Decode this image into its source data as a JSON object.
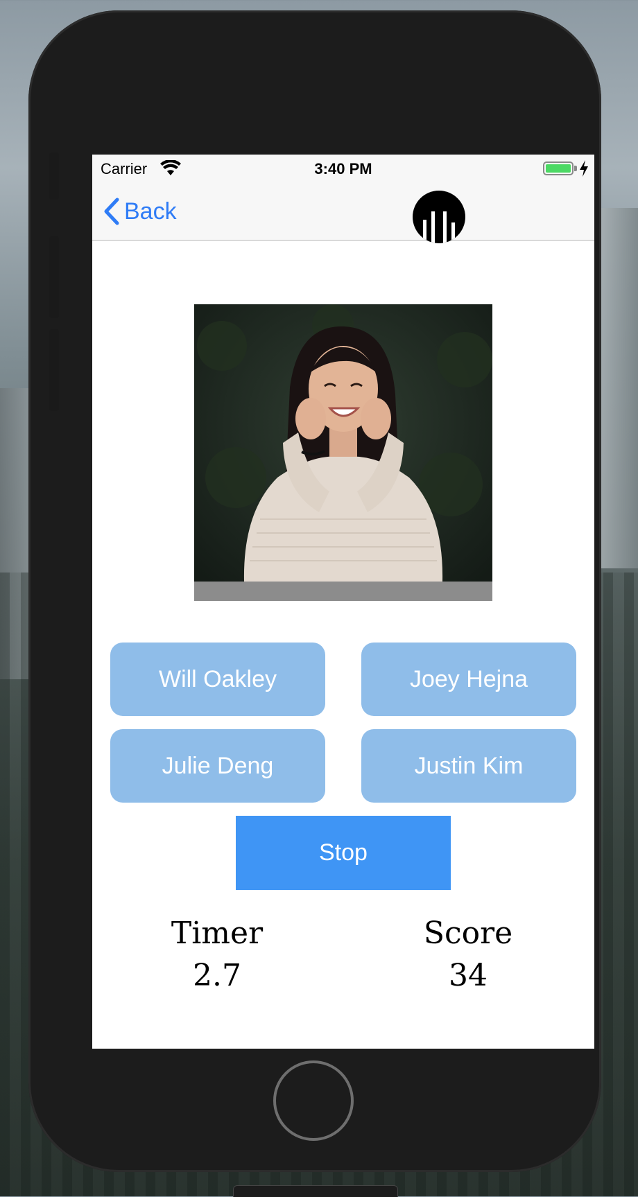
{
  "status_bar": {
    "carrier": "Carrier",
    "time": "3:40 PM",
    "battery_level": 1.0
  },
  "nav": {
    "back_label": "Back",
    "back_icon": "chevron-left-icon",
    "logo_icon": "bar-chart-logo-icon"
  },
  "photo": {
    "description_icon": "person-photo"
  },
  "choices": [
    {
      "label": "Will Oakley"
    },
    {
      "label": "Joey Hejna"
    },
    {
      "label": "Julie Deng"
    },
    {
      "label": "Justin Kim"
    }
  ],
  "stop_button": {
    "label": "Stop"
  },
  "stats": {
    "timer_label": "Timer",
    "timer_value": "2.7",
    "score_label": "Score",
    "score_value": "34"
  },
  "colors": {
    "accent": "#2f7cf6",
    "choice_bg": "#8fbde9",
    "stop_bg": "#3f95f5",
    "battery": "#4cd964"
  }
}
